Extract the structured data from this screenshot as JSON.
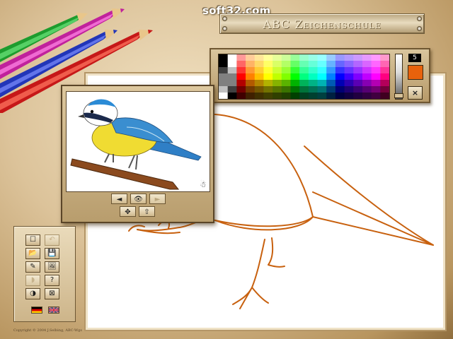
{
  "watermark": "soft32.com",
  "app": {
    "title": "ABC Zeichenschule"
  },
  "palette": {
    "hues": [
      "#ff0000",
      "#ff8000",
      "#ffc000",
      "#ffff00",
      "#c0ff00",
      "#80ff00",
      "#00ff00",
      "#00ff80",
      "#00ffc0",
      "#00ffff",
      "#0080ff",
      "#0000ff",
      "#4000ff",
      "#8000ff",
      "#c000ff",
      "#ff00ff",
      "#ff0080"
    ],
    "grays": [
      "#ffffff",
      "#c0c0c0",
      "#808080",
      "#404040",
      "#000000"
    ],
    "brush_size": "5",
    "current_color": "#e8620c",
    "clear_label": "×"
  },
  "template": {
    "buttons": {
      "prev": "◄",
      "eye": "👁",
      "next": "►",
      "move": "✥",
      "close": "⇧"
    },
    "hint_icon": "☃"
  },
  "toolbox": {
    "tools": [
      {
        "name": "new-page-button",
        "glyph": "☐",
        "enabled": true
      },
      {
        "name": "undo-button",
        "glyph": "↶",
        "enabled": false
      },
      {
        "name": "open-folder-button",
        "glyph": "📂",
        "enabled": true
      },
      {
        "name": "save-button",
        "glyph": "💾",
        "enabled": true
      },
      {
        "name": "pencil-tool-button",
        "glyph": "✎",
        "enabled": true
      },
      {
        "name": "picture-button",
        "glyph": "🖼",
        "enabled": true
      },
      {
        "name": "disabled-tool-button",
        "glyph": "◗",
        "enabled": false
      },
      {
        "name": "help-button",
        "glyph": "?",
        "enabled": true
      },
      {
        "name": "color-picker-button",
        "glyph": "◑",
        "enabled": true
      },
      {
        "name": "exit-button",
        "glyph": "⊠",
        "enabled": true
      }
    ],
    "languages": [
      "de",
      "en"
    ]
  },
  "copyright": "Copyright © 2004 J.Selbing, ABC-Wgs"
}
